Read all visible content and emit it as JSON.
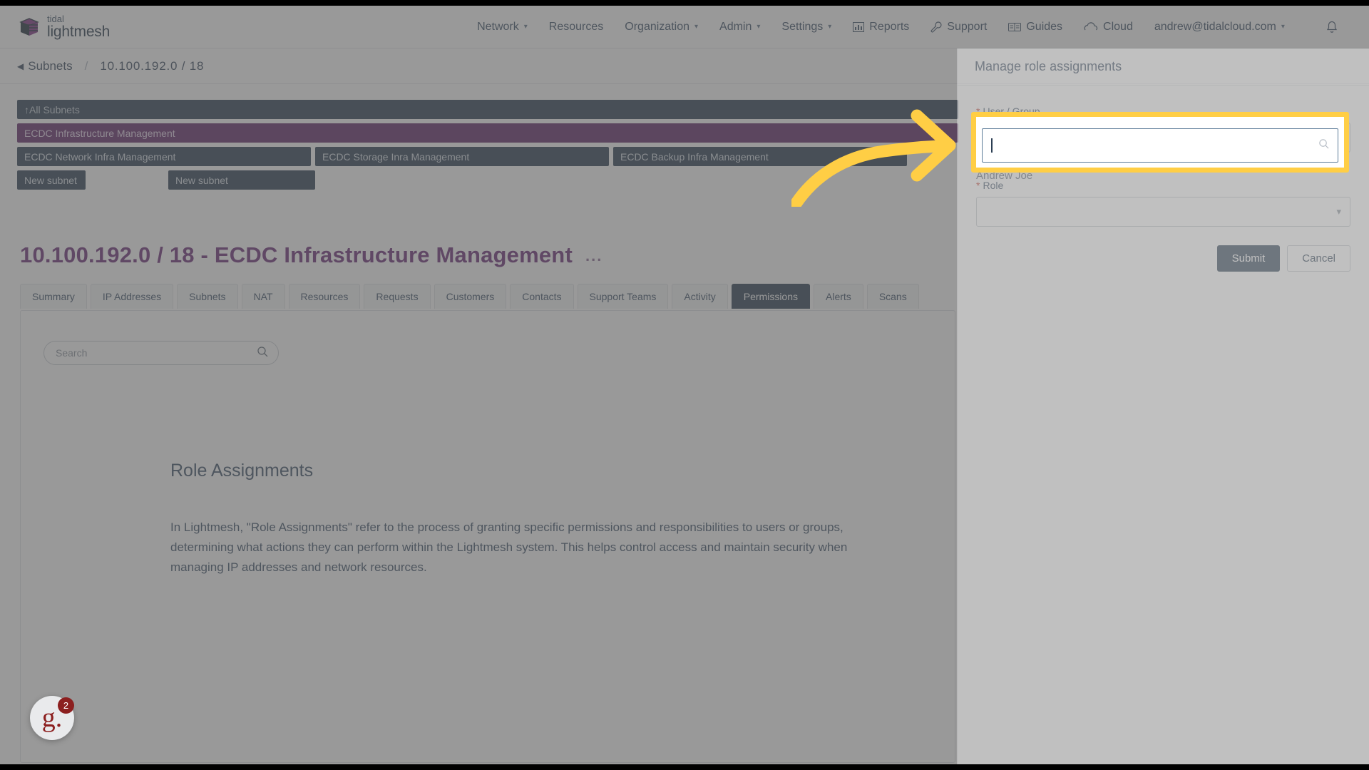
{
  "brand": {
    "line1": "tidal",
    "line2": "lightmesh"
  },
  "nav": {
    "items": [
      {
        "label": "Network",
        "caret": true,
        "icon": null
      },
      {
        "label": "Resources",
        "caret": false,
        "icon": null
      },
      {
        "label": "Organization",
        "caret": true,
        "icon": null
      },
      {
        "label": "Admin",
        "caret": true,
        "icon": null
      },
      {
        "label": "Settings",
        "caret": true,
        "icon": null
      },
      {
        "label": "Reports",
        "caret": false,
        "icon": "chart-icon"
      },
      {
        "label": "Support",
        "caret": false,
        "icon": "wrench-icon"
      },
      {
        "label": "Guides",
        "caret": false,
        "icon": "book-icon"
      },
      {
        "label": "Cloud",
        "caret": false,
        "icon": "cloud-icon"
      },
      {
        "label": "andrew@tidalcloud.com",
        "caret": true,
        "icon": null
      }
    ],
    "notification_icon": "bell-icon"
  },
  "breadcrumb": {
    "back_icon": "chevron-left-icon",
    "back_label": "Subnets",
    "separator": "/",
    "current": "10.100.192.0 / 18"
  },
  "subnet_map": {
    "all_subnets_label": "All Subnets",
    "all_subnets_icon": "arrow-up-icon",
    "selected": "ECDC Infrastructure Management",
    "children": [
      "ECDC Network Infra Management",
      "ECDC Storage Inra Management",
      "ECDC Backup Infra Management"
    ],
    "new_subnet_label": "New subnet",
    "new_subnet_buttons": [
      "New subnet",
      "New subnet"
    ]
  },
  "page": {
    "title": "10.100.192.0 / 18 - ECDC Infrastructure Management",
    "overflow_menu": "..."
  },
  "tabs": [
    {
      "label": "Summary",
      "active": false
    },
    {
      "label": "IP Addresses",
      "active": false
    },
    {
      "label": "Subnets",
      "active": false
    },
    {
      "label": "NAT",
      "active": false
    },
    {
      "label": "Resources",
      "active": false
    },
    {
      "label": "Requests",
      "active": false
    },
    {
      "label": "Customers",
      "active": false
    },
    {
      "label": "Contacts",
      "active": false
    },
    {
      "label": "Support Teams",
      "active": false
    },
    {
      "label": "Activity",
      "active": false
    },
    {
      "label": "Permissions",
      "active": true
    },
    {
      "label": "Alerts",
      "active": false
    },
    {
      "label": "Scans",
      "active": false
    }
  ],
  "content": {
    "search": {
      "value": "",
      "placeholder": "Search",
      "icon": "search-icon"
    },
    "heading": "Role Assignments",
    "body": "In Lightmesh, \"Role Assignments\" refer to the process of granting specific permissions and responsibilities to users or groups, determining what actions they can perform within the Lightmesh system. This helps control access and maintain security when managing IP addresses and network resources."
  },
  "guide_badge": {
    "letter": "g.",
    "count": "2"
  },
  "panel": {
    "title": "Manage role assignments",
    "user_group": {
      "label": "User / Group",
      "required_marker": "*",
      "value": "",
      "selected_text": "Andrew Joe",
      "search_icon": "search-icon"
    },
    "role": {
      "label": "Role",
      "required_marker": "*",
      "value": "",
      "chevron_icon": "chevron-down-icon"
    },
    "submit_label": "Submit",
    "cancel_label": "Cancel"
  },
  "annotation": {
    "highlight_color": "#ffce45",
    "arrow_color": "#ffce45",
    "arrow_icon": "curved-arrow-right-icon"
  },
  "colors": {
    "brand_purple": "#6b2c77",
    "navy": "#2b3e53",
    "selected_subnet": "#5f2667",
    "accent_yellow": "#ffce45"
  }
}
